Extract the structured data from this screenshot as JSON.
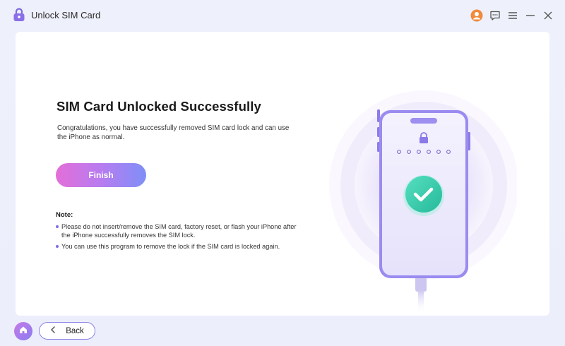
{
  "titlebar": {
    "app_title": "Unlock SIM Card",
    "icons": [
      "lock-logo-icon",
      "avatar-icon",
      "feedback-icon",
      "menu-icon",
      "minimize-icon",
      "close-icon"
    ]
  },
  "main": {
    "heading": "SIM Card Unlocked Successfully",
    "description": "Congratulations, you have successfully removed SIM card lock and can use the iPhone as normal.",
    "finish_label": "Finish",
    "note_title": "Note:",
    "notes": [
      "Please do not insert/remove the SIM card, factory reset, or flash your iPhone after the iPhone successfully removes the SIM lock.",
      "You can use this program to remove the lock if the SIM card is locked again."
    ]
  },
  "illustration": {
    "icons": [
      "phone-icon",
      "lock-icon",
      "checkmark-icon",
      "cable-icon"
    ],
    "passcode_dots": 6
  },
  "footer": {
    "back_label": "Back",
    "icons": [
      "home-icon",
      "chevron-left-icon"
    ]
  },
  "colors": {
    "accent": "#8b7cf0",
    "success": "#3ecfae",
    "finish_gradient_start": "#e36ed8",
    "finish_gradient_end": "#7f8ff7"
  }
}
